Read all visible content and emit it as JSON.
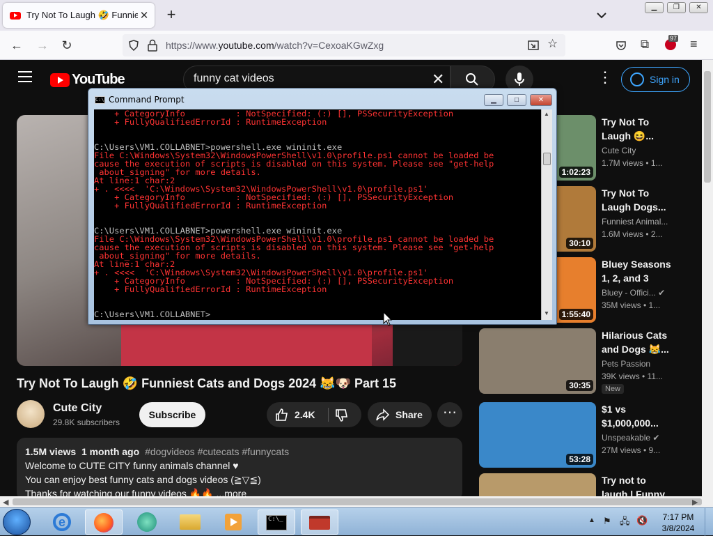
{
  "browser": {
    "tab_title": "Try Not To Laugh 🤣 Funniest C",
    "tab_close": "✕",
    "new_tab": "+",
    "url_prefix": "https://www.",
    "url_host": "youtube.com",
    "url_path": "/watch?v=CexoaKGwZxg",
    "extension_badge": "97"
  },
  "youtube": {
    "logo_text": "YouTube",
    "search_query": "funny cat videos",
    "sign_in": "Sign in",
    "video_title": "Try Not To Laugh 🤣 Funniest Cats and Dogs 2024 😹🐶 Part 15",
    "channel_name": "Cute City",
    "subscribers": "29.8K subscribers",
    "subscribe_label": "Subscribe",
    "likes": "2.4K",
    "share_label": "Share",
    "more_label": "⋯",
    "views": "1.5M views",
    "posted": "1 month ago",
    "tags": "#dogvideos #cutecats #funnycats",
    "desc_line1": "Welcome to CUTE CITY funny animals channel ♥",
    "desc_line2": "You can enjoy best funny cats and dogs videos (≧▽≦)",
    "desc_line3": "Thanks for watching our funny videos 🔥🔥 ...more"
  },
  "related": [
    {
      "title": "Try Not To Laugh 😆...",
      "channel": "Cute City",
      "meta": "1.7M views • 1...",
      "duration": "1:02:23",
      "color": "#6c8f6a"
    },
    {
      "title": "Try Not To Laugh Dogs...",
      "channel": "Funniest Animal...",
      "meta": "1.6M views • 2...",
      "duration": "30:10",
      "color": "#b07a3a"
    },
    {
      "title": "Bluey Seasons 1, 2, and 3 FU...",
      "channel": "Bluey - Offici... ✔",
      "meta": "35M views • 1...",
      "duration": "1:55:40",
      "color": "#e77f2d"
    },
    {
      "title": "Hilarious Cats and Dogs 😹...",
      "channel": "Pets Passion",
      "meta": "39K views • 11...",
      "duration": "30:35",
      "badge": "New",
      "color": "#8a7e6e"
    },
    {
      "title": "$1 vs $1,000,000...",
      "channel": "Unspeakable ✔",
      "meta": "27M views • 9...",
      "duration": "53:28",
      "color": "#3a88c9"
    },
    {
      "title": "Try not to laugh | Funny cats",
      "channel": "",
      "meta": "",
      "duration": "",
      "color": "#b89a6a"
    }
  ],
  "cmd": {
    "title": "Command Prompt",
    "lines": [
      {
        "t": "    + CategoryInfo          : NotSpecified: (:) [], PSSecurityException",
        "e": true
      },
      {
        "t": "    + FullyQualifiedErrorId : RuntimeException",
        "e": true
      },
      {
        "t": "",
        "e": false
      },
      {
        "t": "",
        "e": false
      },
      {
        "t": "C:\\Users\\VM1.COLLABNET>powershell.exe wininit.exe",
        "e": false
      },
      {
        "t": "File C:\\Windows\\System32\\WindowsPowerShell\\v1.0\\profile.ps1 cannot be loaded be",
        "e": true
      },
      {
        "t": "cause the execution of scripts is disabled on this system. Please see \"get-help",
        "e": true
      },
      {
        "t": " about_signing\" for more details.",
        "e": true
      },
      {
        "t": "At line:1 char:2",
        "e": true
      },
      {
        "t": "+ . <<<<  'C:\\Windows\\System32\\WindowsPowerShell\\v1.0\\profile.ps1'",
        "e": true
      },
      {
        "t": "    + CategoryInfo          : NotSpecified: (:) [], PSSecurityException",
        "e": true
      },
      {
        "t": "    + FullyQualifiedErrorId : RuntimeException",
        "e": true
      },
      {
        "t": "",
        "e": false
      },
      {
        "t": "",
        "e": false
      },
      {
        "t": "C:\\Users\\VM1.COLLABNET>powershell.exe wininit.exe",
        "e": false
      },
      {
        "t": "File C:\\Windows\\System32\\WindowsPowerShell\\v1.0\\profile.ps1 cannot be loaded be",
        "e": true
      },
      {
        "t": "cause the execution of scripts is disabled on this system. Please see \"get-help",
        "e": true
      },
      {
        "t": " about_signing\" for more details.",
        "e": true
      },
      {
        "t": "At line:1 char:2",
        "e": true
      },
      {
        "t": "+ . <<<<  'C:\\Windows\\System32\\WindowsPowerShell\\v1.0\\profile.ps1'",
        "e": true
      },
      {
        "t": "    + CategoryInfo          : NotSpecified: (:) [], PSSecurityException",
        "e": true
      },
      {
        "t": "    + FullyQualifiedErrorId : RuntimeException",
        "e": true
      },
      {
        "t": "",
        "e": false
      },
      {
        "t": "",
        "e": false
      },
      {
        "t": "C:\\Users\\VM1.COLLABNET>",
        "e": false
      }
    ]
  },
  "taskbar": {
    "time": "7:17 PM",
    "date": "3/8/2024"
  }
}
